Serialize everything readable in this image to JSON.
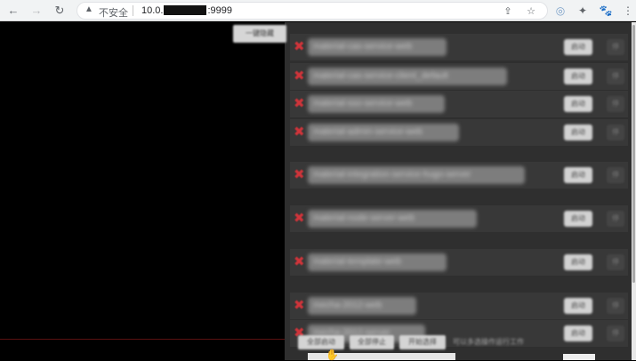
{
  "browser": {
    "back_icon": "←",
    "forward_icon": "→",
    "reload_icon": "↻",
    "security_icon": "▲",
    "security_label": "不安全",
    "url_prefix": "10.0.",
    "url_suffix": ":9999",
    "share_icon": "⇪",
    "bookmark_icon": "☆",
    "extension_icons": [
      "◎",
      "✦",
      "🐾",
      "⋮"
    ]
  },
  "page": {
    "collapse_label": "一键隐藏",
    "rows": [
      {
        "name": "material-cas-service-web",
        "action": "启动",
        "side": "停"
      },
      {
        "name": "material-cas-service-client_default",
        "action": "启动",
        "side": "停"
      },
      {
        "name": "material-sso-service-web",
        "action": "启动",
        "side": "停"
      },
      {
        "name": "material-admin-service-web",
        "action": "启动",
        "side": "停"
      },
      {
        "name": "material-integration-service-hugo-server",
        "action": "启动",
        "side": "停"
      },
      {
        "name": "material-node-server-web",
        "action": "启动",
        "side": "停"
      },
      {
        "name": "material-template-web",
        "action": "启动",
        "side": "停"
      },
      {
        "name": "mecha-2012-web",
        "action": "启动",
        "side": "停"
      },
      {
        "name": "mecha-2012-server",
        "action": "启动",
        "side": "停"
      }
    ],
    "bottom_buttons": [
      "全部启动",
      "全部停止",
      "开始选择"
    ],
    "bottom_hint": "可以多选操作运行工作"
  },
  "colors": {
    "panel_bg": "#2f2f2f",
    "left_bg": "#000000",
    "error_x": "#d0343a"
  }
}
